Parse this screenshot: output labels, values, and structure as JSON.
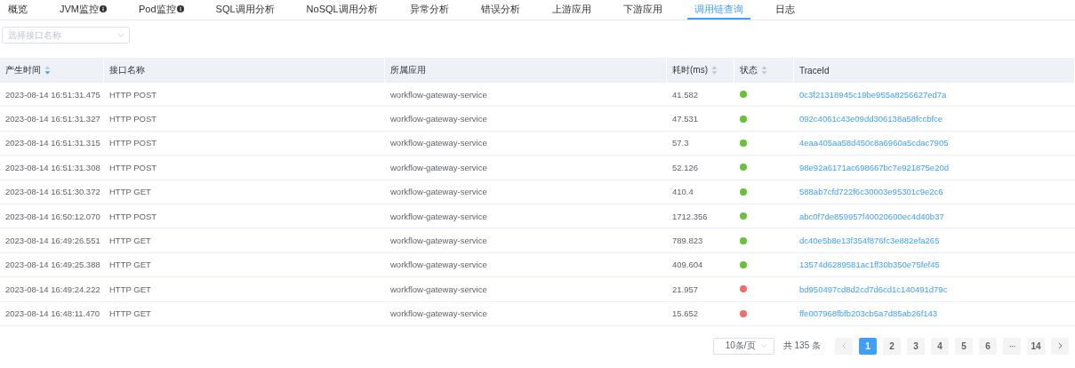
{
  "tabs": [
    {
      "label": "概览",
      "selected": false,
      "info": false
    },
    {
      "label": "JVM监控",
      "selected": false,
      "info": true
    },
    {
      "label": "Pod监控",
      "selected": false,
      "info": true
    },
    {
      "label": "SQL调用分析",
      "selected": false,
      "info": false
    },
    {
      "label": "NoSQL调用分析",
      "selected": false,
      "info": false
    },
    {
      "label": "异常分析",
      "selected": false,
      "info": false
    },
    {
      "label": "错误分析",
      "selected": false,
      "info": false
    },
    {
      "label": "上游应用",
      "selected": false,
      "info": false
    },
    {
      "label": "下游应用",
      "selected": false,
      "info": false
    },
    {
      "label": "调用链查询",
      "selected": true,
      "info": false
    },
    {
      "label": "日志",
      "selected": false,
      "info": false
    }
  ],
  "filter": {
    "placeholder": "选择接口名称"
  },
  "table": {
    "columns": [
      {
        "label": "产生时间",
        "sortable": true,
        "sorted_descending": true
      },
      {
        "label": "接口名称",
        "sortable": false
      },
      {
        "label": "所属应用",
        "sortable": false
      },
      {
        "label": "耗时(ms)",
        "sortable": true,
        "sorted_descending": false
      },
      {
        "label": "状态",
        "sortable": true,
        "sorted_descending": false
      },
      {
        "label": "TraceId",
        "sortable": false
      }
    ],
    "rows": [
      {
        "time": "2023-08-14 16:51:31.475",
        "name": "HTTP POST",
        "app": "workflow-gateway-service",
        "duration": "41.582",
        "color": "#67c23a",
        "trace_id": "0c3f21318945c19be955a8256627ed7a"
      },
      {
        "time": "2023-08-14 16:51:31.327",
        "name": "HTTP POST",
        "app": "workflow-gateway-service",
        "duration": "47.531",
        "color": "#67c23a",
        "trace_id": "092c4061c43e09dd306138a58fccbfce"
      },
      {
        "time": "2023-08-14 16:51:31.315",
        "name": "HTTP POST",
        "app": "workflow-gateway-service",
        "duration": "57.3",
        "color": "#67c23a",
        "trace_id": "4eaa405aa58d450c8a6960a5cdac7905"
      },
      {
        "time": "2023-08-14 16:51:31.308",
        "name": "HTTP POST",
        "app": "workflow-gateway-service",
        "duration": "52.126",
        "color": "#67c23a",
        "trace_id": "98e92a6171ac698667bc7e921875e20d"
      },
      {
        "time": "2023-08-14 16:51:30.372",
        "name": "HTTP GET",
        "app": "workflow-gateway-service",
        "duration": "410.4",
        "color": "#67c23a",
        "trace_id": "588ab7cfd722f6c30003e95301c9e2c6"
      },
      {
        "time": "2023-08-14 16:50:12.070",
        "name": "HTTP POST",
        "app": "workflow-gateway-service",
        "duration": "1712.356",
        "color": "#67c23a",
        "trace_id": "abc0f7de859957f40020600ec4d40b37"
      },
      {
        "time": "2023-08-14 16:49:26.551",
        "name": "HTTP GET",
        "app": "workflow-gateway-service",
        "duration": "789.823",
        "color": "#67c23a",
        "trace_id": "dc40e5b8e13f354f876fc3e882efa265"
      },
      {
        "time": "2023-08-14 16:49:25.388",
        "name": "HTTP GET",
        "app": "workflow-gateway-service",
        "duration": "409.604",
        "color": "#67c23a",
        "trace_id": "13574d6289581ac1ff30b350e75fef45"
      },
      {
        "time": "2023-08-14 16:49:24.222",
        "name": "HTTP GET",
        "app": "workflow-gateway-service",
        "duration": "21.957",
        "color": "#f56c6c",
        "trace_id": "bd950497cd8d2cd7d6cd1c140491d79c"
      },
      {
        "time": "2023-08-14 16:48:11.470",
        "name": "HTTP GET",
        "app": "workflow-gateway-service",
        "duration": "15.652",
        "color": "#f56c6c",
        "trace_id": "ffe007968fbfb203cb5a7d85ab26f143"
      }
    ]
  },
  "pagination": {
    "page_size": "10条/页",
    "total": "共 135 条",
    "pages": [
      {
        "label": "1",
        "kind": "page",
        "selected": true
      },
      {
        "label": "2",
        "kind": "page",
        "selected": false
      },
      {
        "label": "3",
        "kind": "page",
        "selected": false
      },
      {
        "label": "4",
        "kind": "page",
        "selected": false
      },
      {
        "label": "5",
        "kind": "page",
        "selected": false
      },
      {
        "label": "6",
        "kind": "page",
        "selected": false
      },
      {
        "label": "···",
        "kind": "ellipsis",
        "selected": false
      },
      {
        "label": "14",
        "kind": "page",
        "selected": false
      }
    ]
  }
}
